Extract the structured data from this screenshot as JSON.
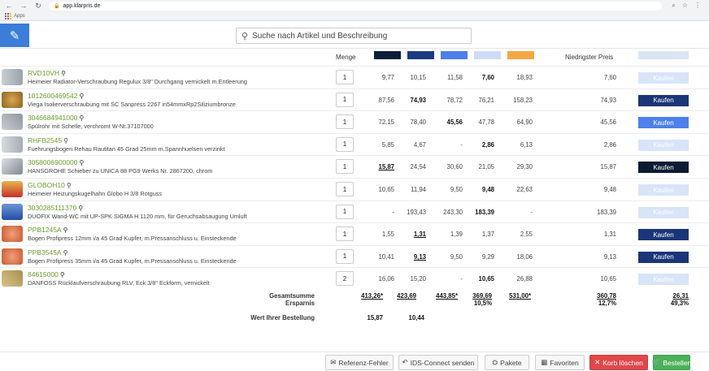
{
  "browser": {
    "url": "app.klarpris.de",
    "bookmark_apps": "Apps"
  },
  "header": {
    "search_placeholder": "Suche nach Artikel und Beschreibung"
  },
  "columns": {
    "menge": "Menge",
    "niedrigster_preis": "Niedrigster Preis",
    "supplier_colors": [
      "#0b1d3a",
      "#1b3a80",
      "#4d7fe8",
      "#cfdcf8",
      "#f2a944"
    ]
  },
  "colors": {
    "kaufen_colors": {
      "light": "#d8e4f8",
      "navy": "#1a3578",
      "blue": "#4c80ea",
      "dark": "#0c1a33"
    }
  },
  "rows": [
    {
      "article": "RVD10VH",
      "desc": "Heimeier Radiator-Verschraubung Regulux 3/8\" Durchgang vernickelt m.Entleerung",
      "qty": "1",
      "prices": [
        "9,77",
        "10,15",
        "11,58",
        "7,60",
        "18,93"
      ],
      "best": 3,
      "lowest": "7,60",
      "kaufen": "Kaufen",
      "kaufen_color": "light"
    },
    {
      "article": "1012600469542",
      "desc": "Viega Isolierverschraubung mit SC Sanpress 2267 in54mmxRp2Siliziumbronze",
      "qty": "1",
      "prices": [
        "87,56",
        "74,93",
        "78,72",
        "76,21",
        "158,23"
      ],
      "best": 1,
      "lowest": "74,93",
      "kaufen": "Kaufen",
      "kaufen_color": "navy"
    },
    {
      "article": "3046684941000",
      "desc": "Spülrohr mit Schelle, verchromt W-Nr.37107000",
      "qty": "1",
      "prices": [
        "72,15",
        "78,40",
        "45,56",
        "47,78",
        "64,90"
      ],
      "best": 2,
      "lowest": "45,56",
      "kaufen": "Kaufen",
      "kaufen_color": "blue"
    },
    {
      "article": "RHFB2545",
      "desc": "Fuehrungsbogen Rehau Rautitan 45 Grad 25mm m.Spannhuelsen verzinkt",
      "qty": "1",
      "prices": [
        "5,85",
        "4,67",
        "-",
        "2,86",
        "6,13"
      ],
      "best": 3,
      "lowest": "2,86",
      "kaufen": "Kaufen",
      "kaufen_color": "light"
    },
    {
      "article": "3058006900000",
      "desc": "HANSGROHE Schieber zu UNICA 88 PG9 Werks Nr. 2867200, chrom",
      "qty": "1",
      "prices": [
        "15,87",
        "24,54",
        "30,60",
        "21,05",
        "29,30"
      ],
      "best": 0,
      "best_ul": true,
      "lowest": "15,87",
      "kaufen": "Kaufen",
      "kaufen_color": "dark"
    },
    {
      "article": "GLOBOH10",
      "desc": "Heimeier Heizungskugelhahn Globo H 3/8 Rotguss",
      "qty": "1",
      "prices": [
        "10,65",
        "11,94",
        "9,50",
        "9,48",
        "22,63"
      ],
      "best": 3,
      "lowest": "9,48",
      "kaufen": "Kaufen",
      "kaufen_color": "light"
    },
    {
      "article": "3030285111370",
      "desc": "DUOFIX Wand-WC mit UP-SPK SIGMA H 1120 mm, für Geruchsabsaugung Umluft",
      "qty": "1",
      "prices": [
        "-",
        "193,43",
        "243,30",
        "183,39",
        "-"
      ],
      "best": 3,
      "lowest": "183,39",
      "kaufen": "Kaufen",
      "kaufen_color": "light"
    },
    {
      "article": "PPB1245A",
      "desc": "Bogen Profipress 12mm i/a 45 Grad Kupfer, m.Pressanschluss u. Einsteckende",
      "qty": "1",
      "prices": [
        "1,55",
        "1,31",
        "1,39",
        "1,37",
        "2,55"
      ],
      "best": 1,
      "best_ul": true,
      "lowest": "1,31",
      "kaufen": "Kaufen",
      "kaufen_color": "navy"
    },
    {
      "article": "PPB3545A",
      "desc": "Bogen Profipress 35mm i/a 45 Grad Kupfer, m.Pressanschluss u. Einsteckende",
      "qty": "1",
      "prices": [
        "10,41",
        "9,13",
        "9,50",
        "9,29",
        "18,06"
      ],
      "best": 1,
      "best_ul": true,
      "lowest": "9,13",
      "kaufen": "Kaufen",
      "kaufen_color": "navy"
    },
    {
      "article": "84615000",
      "desc": "DANFOSS Rücklaufverschraubung RLV, Eck 3/8\" Eckform, vernickelt",
      "qty": "2",
      "prices": [
        "16,06",
        "15,20",
        "-",
        "10,65",
        "26,88"
      ],
      "best": 3,
      "lowest": "10,65",
      "kaufen": "Kaufen",
      "kaufen_color": "light"
    }
  ],
  "summary": {
    "gesamtsumme_label": "Gesamtsumme",
    "ersparnis_label": "Ersparnis",
    "wert_label": "Wert Ihrer Bestellung",
    "totals": [
      "413,26*",
      "423,69",
      "443,85*",
      "369,69",
      "531,00*"
    ],
    "savings": [
      "",
      "",
      "",
      "10,5%",
      ""
    ],
    "lowest_total": "360,78",
    "lowest_saving": "12,7%",
    "kaufen_total": "26,31",
    "kaufen_saving": "49,3%",
    "wert": [
      "15,87",
      "10,44"
    ]
  },
  "footer": {
    "referenz": "Referenz-Fehler",
    "ids": "IDS-Connect senden",
    "pakete": "Pakete",
    "favoriten": "Favoriten",
    "korb": "Korb löschen",
    "bestellen": "Bestellen"
  }
}
